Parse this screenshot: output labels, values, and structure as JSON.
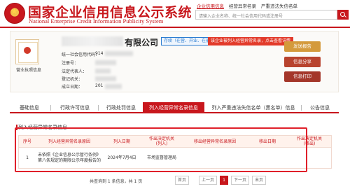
{
  "header": {
    "title": "国家企业信用信息公示系统",
    "subtitle": "National Enterprise Credit Information Publicity System",
    "links": [
      "企业信用信息",
      "经营异常名录",
      "严重违法失信名单"
    ],
    "search_placeholder": "请输入企业名称、统一社会信用代码或注册号"
  },
  "company": {
    "name_suffix": "有限公司",
    "status_tag": "存续（在营、开业、在册）",
    "warning_tag": "该企业被列入经营异常名录，点击查看详情",
    "certificate_caption": "营业执照信息",
    "fields": [
      {
        "label": "统一社会信用代码：",
        "value": "914"
      },
      {
        "label": "注册号：",
        "value": ""
      },
      {
        "label": "法定代表人：",
        "value": ""
      },
      {
        "label": "登记机关：",
        "value": ""
      },
      {
        "label": "成立日期：",
        "value": "201"
      }
    ],
    "buttons": {
      "report": "发送报告",
      "share": "信息分享",
      "print": "信息打印"
    }
  },
  "tabs": [
    {
      "label": "基础信息",
      "active": false
    },
    {
      "label": "行政许可信息",
      "active": false
    },
    {
      "label": "行政处罚信息",
      "active": false
    },
    {
      "label": "列入经营异常名录信息",
      "active": true
    },
    {
      "label": "列入严重违法失信名单（黑名单）信息",
      "active": false
    },
    {
      "label": "公告信息",
      "active": false
    }
  ],
  "section": {
    "title": "列入经营异常名录信息",
    "columns": [
      "序号",
      "列入经营异常名录原因",
      "列入日期",
      "作出决定机关\n(列入)",
      "移出经营异常名录原因",
      "移出日期",
      "作出决定机关\n(移出)"
    ],
    "rows": [
      {
        "index": "1",
        "reason": "未依照《企业信息公示暂行条例》第八条规定的期限公示年度报告的",
        "date": "2024年7月4日",
        "authority": "市场监督管理局",
        "remove_reason": "",
        "remove_date": "",
        "remove_authority": ""
      }
    ]
  },
  "pager": {
    "info": "共查询到 1 条信息，共 1 页",
    "first": "首页",
    "prev": "上一页",
    "current": "1",
    "next": "下一页",
    "last": "末页"
  },
  "colors": {
    "brand_red": "#c8171d",
    "highlight_red": "#e0202a",
    "status_blue": "#2a7bd0"
  }
}
